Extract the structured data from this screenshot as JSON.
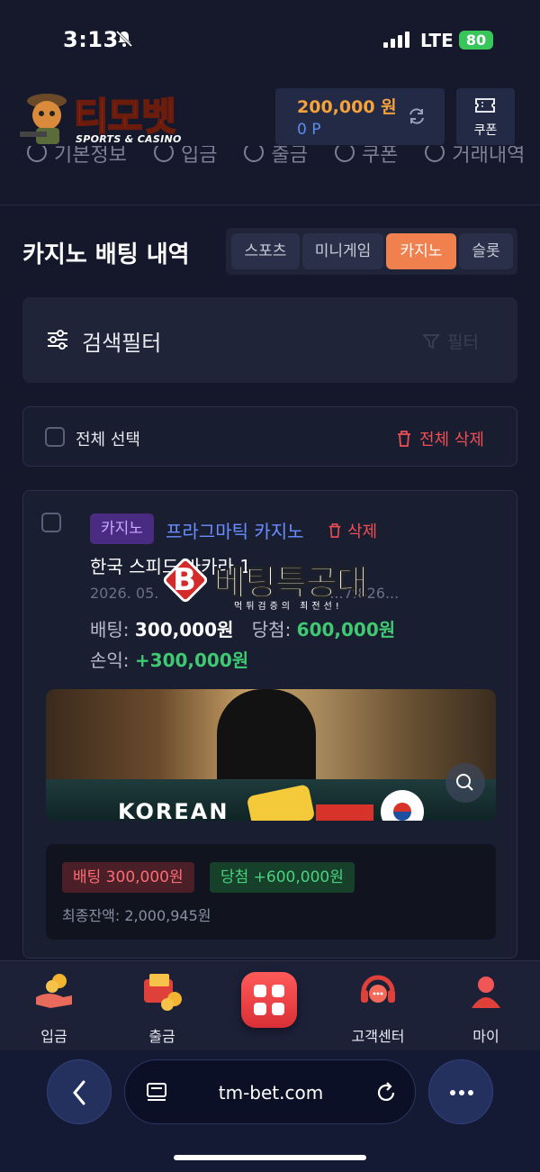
{
  "status": {
    "time": "3:13",
    "network": "LTE",
    "battery": "80"
  },
  "header": {
    "logo_text": "티모벳",
    "logo_sub": "SPORTS & CASINO",
    "balance": "200,000 원",
    "points": "0 P",
    "coupon_label": "쿠폰",
    "nav": [
      "기본정보",
      "입금",
      "출금",
      "쿠폰",
      "거래내역"
    ]
  },
  "page": {
    "title": "카지노 배팅 내역",
    "tabs": [
      "스포츠",
      "미니게임",
      "카지노",
      "슬롯"
    ],
    "active_tab": "카지노"
  },
  "filter": {
    "label": "검색필터",
    "button": "필터"
  },
  "selectbar": {
    "select_all": "전체 선택",
    "delete_all": "전체 삭제"
  },
  "card": {
    "badge": "카지노",
    "provider": "프라그마틱 카지노",
    "delete": "삭제",
    "game": "한국 스피드 바카라 1",
    "date": "2026. 05.",
    "date_tail": "...7f826...",
    "bet_label": "배팅:",
    "bet_value": "300,000원",
    "win_label": "당첨:",
    "win_value": "600,000원",
    "pl_label": "손익:",
    "pl_value": "+300,000원",
    "thumb_text": "KOREAN",
    "summary_bet": "배팅 300,000원",
    "summary_win": "당첨 +600,000원",
    "final_balance": "최종잔액: 2,000,945원"
  },
  "watermark": {
    "title": "베팅특공대",
    "sub": "먹튀검증의 최전선!"
  },
  "bottom_nav": [
    {
      "label": "입금",
      "icon": "deposit-icon"
    },
    {
      "label": "출금",
      "icon": "withdraw-icon"
    },
    {
      "label": "",
      "icon": "menu-grid-icon"
    },
    {
      "label": "고객센터",
      "icon": "support-icon"
    },
    {
      "label": "마이",
      "icon": "user-icon"
    }
  ],
  "browser": {
    "url": "tm-bet.com"
  },
  "colors": {
    "accent": "#f0804e",
    "win": "#3fc971",
    "danger": "#f04e54",
    "bg": "#14182a"
  }
}
